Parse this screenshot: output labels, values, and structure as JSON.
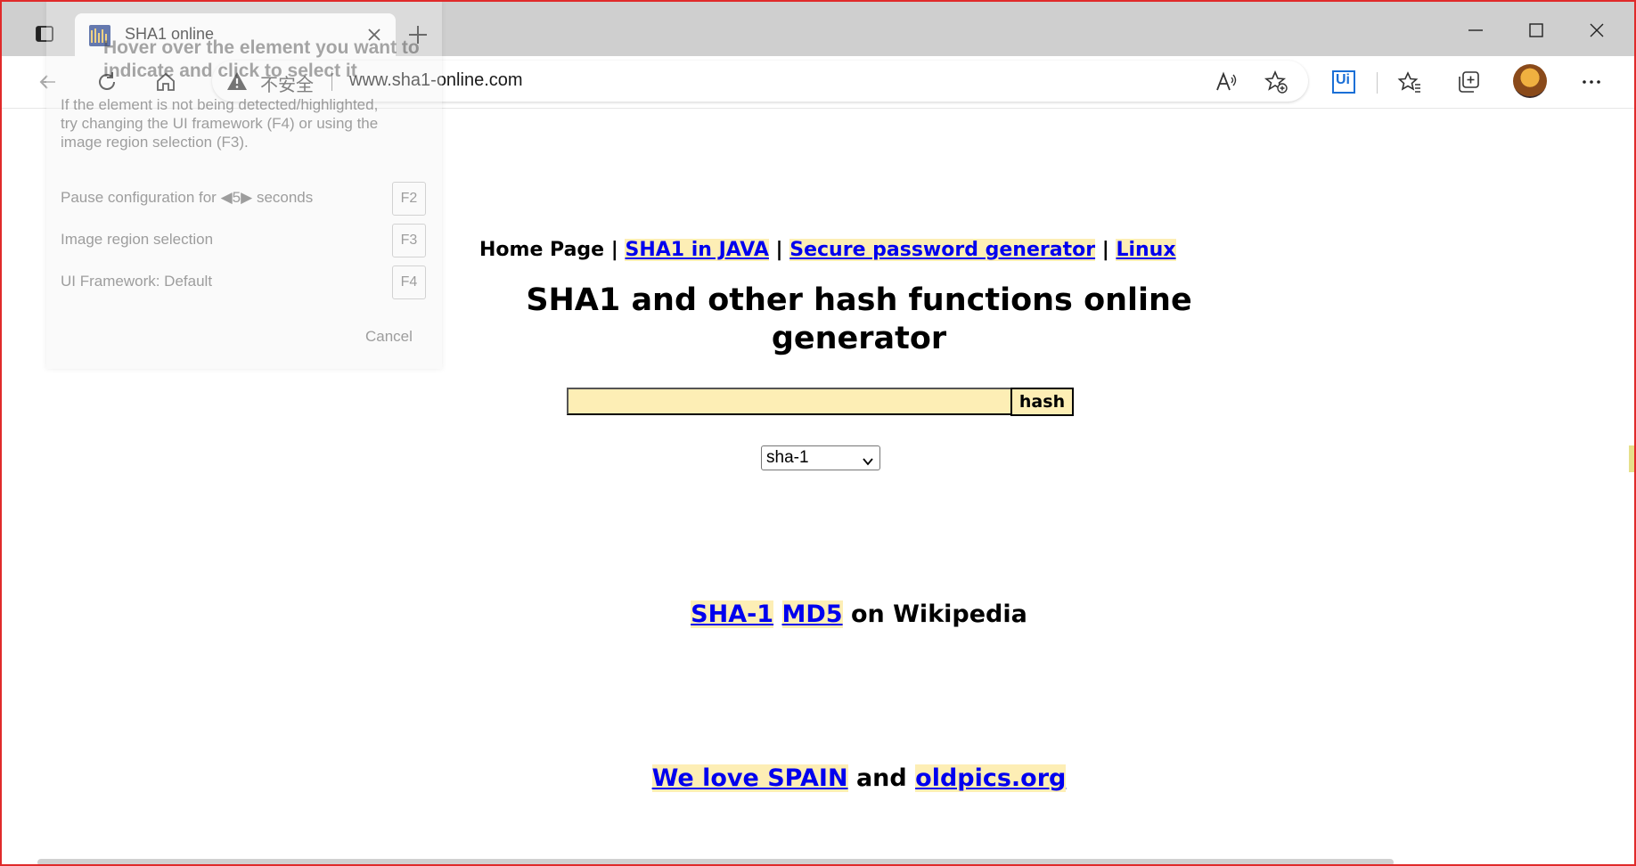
{
  "browser": {
    "tab": {
      "title": "SHA1 online",
      "favicon": "sha1-favicon-icon"
    },
    "address_bar": {
      "security_label": "不安全",
      "url": "www.sha1-online.com"
    },
    "icons": {
      "back": "arrow-left-icon",
      "refresh": "refresh-icon",
      "home": "home-icon",
      "read_aloud": "read-aloud-icon",
      "add_favorite": "star-plus-icon",
      "extension": "uipath-extension-icon",
      "favorites": "favorites-icon",
      "collections": "collections-icon",
      "more": "more-icon"
    },
    "extension_label": "Ui"
  },
  "overlay_panel": {
    "title_lines": [
      "Hover over the element you want to",
      "indicate and click to select it"
    ],
    "hint_lines": [
      "If the element is not being detected/highlighted,",
      "try changing the UI framework (F4) or using the",
      "image region selection (F3)."
    ],
    "pause_label": "Pause configuration for",
    "pause_value": "5",
    "pause_unit": "seconds",
    "pause_key": "F2",
    "image_region_label": "Image region selection",
    "image_region_key": "F3",
    "framework_label": "UI Framework: Default",
    "framework_key": "F4",
    "cancel_label": "Cancel"
  },
  "page": {
    "nav": {
      "home": "Home Page",
      "sep": "|",
      "links": [
        "SHA1 in JAVA",
        "Secure password generator",
        "Linux"
      ]
    },
    "heading": "SHA1 and other hash functions online generator",
    "hash_input": {
      "value": "",
      "placeholder": ""
    },
    "hash_button": "hash",
    "algorithm": {
      "selected": "sha-1"
    },
    "wiki": {
      "links": [
        "SHA-1",
        "MD5"
      ],
      "suffix": "on Wikipedia"
    },
    "promo": {
      "link1": "We love SPAIN",
      "and": "and",
      "link2": "oldpics.org"
    }
  },
  "colors": {
    "link": "#0000ee",
    "link_bg": "#fdeeb5",
    "window_border": "#e02a2a",
    "tabstrip": "#cfcfcf"
  }
}
